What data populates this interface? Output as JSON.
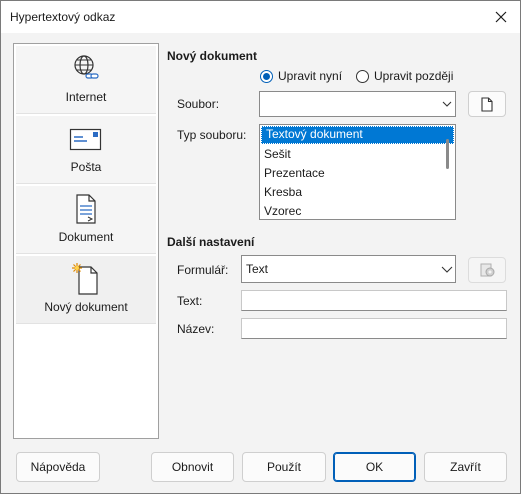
{
  "window": {
    "title": "Hypertextový odkaz",
    "close_icon": "close-icon"
  },
  "sidebar": {
    "items": [
      {
        "label": "Internet",
        "icon": "globe-link-icon"
      },
      {
        "label": "Pošta",
        "icon": "envelope-icon"
      },
      {
        "label": "Dokument",
        "icon": "document-icon"
      },
      {
        "label": "Nový dokument",
        "icon": "new-document-icon",
        "selected": true
      }
    ]
  },
  "new_document": {
    "section_title": "Nový dokument",
    "edit_now_label": "Upravit nyní",
    "edit_later_label": "Upravit později",
    "edit_mode_selected": "Upravit nyní",
    "file_label": "Soubor:",
    "file_value": "",
    "file_type_label": "Typ souboru:",
    "file_types": [
      "Textový dokument",
      "Sešit",
      "Prezentace",
      "Kresba",
      "Vzorec"
    ],
    "selected_file_type": "Textový dokument"
  },
  "other_settings": {
    "section_title": "Další nastavení",
    "form_label": "Formulář:",
    "form_value": "Text",
    "text_label": "Text:",
    "text_value": "",
    "name_label": "Název:",
    "name_value": ""
  },
  "buttons": {
    "help": "Nápověda",
    "reset": "Obnovit",
    "apply": "Použít",
    "ok": "OK",
    "close": "Zavřít"
  },
  "colors": {
    "accent": "#005fb8",
    "selection": "#0078d4"
  }
}
